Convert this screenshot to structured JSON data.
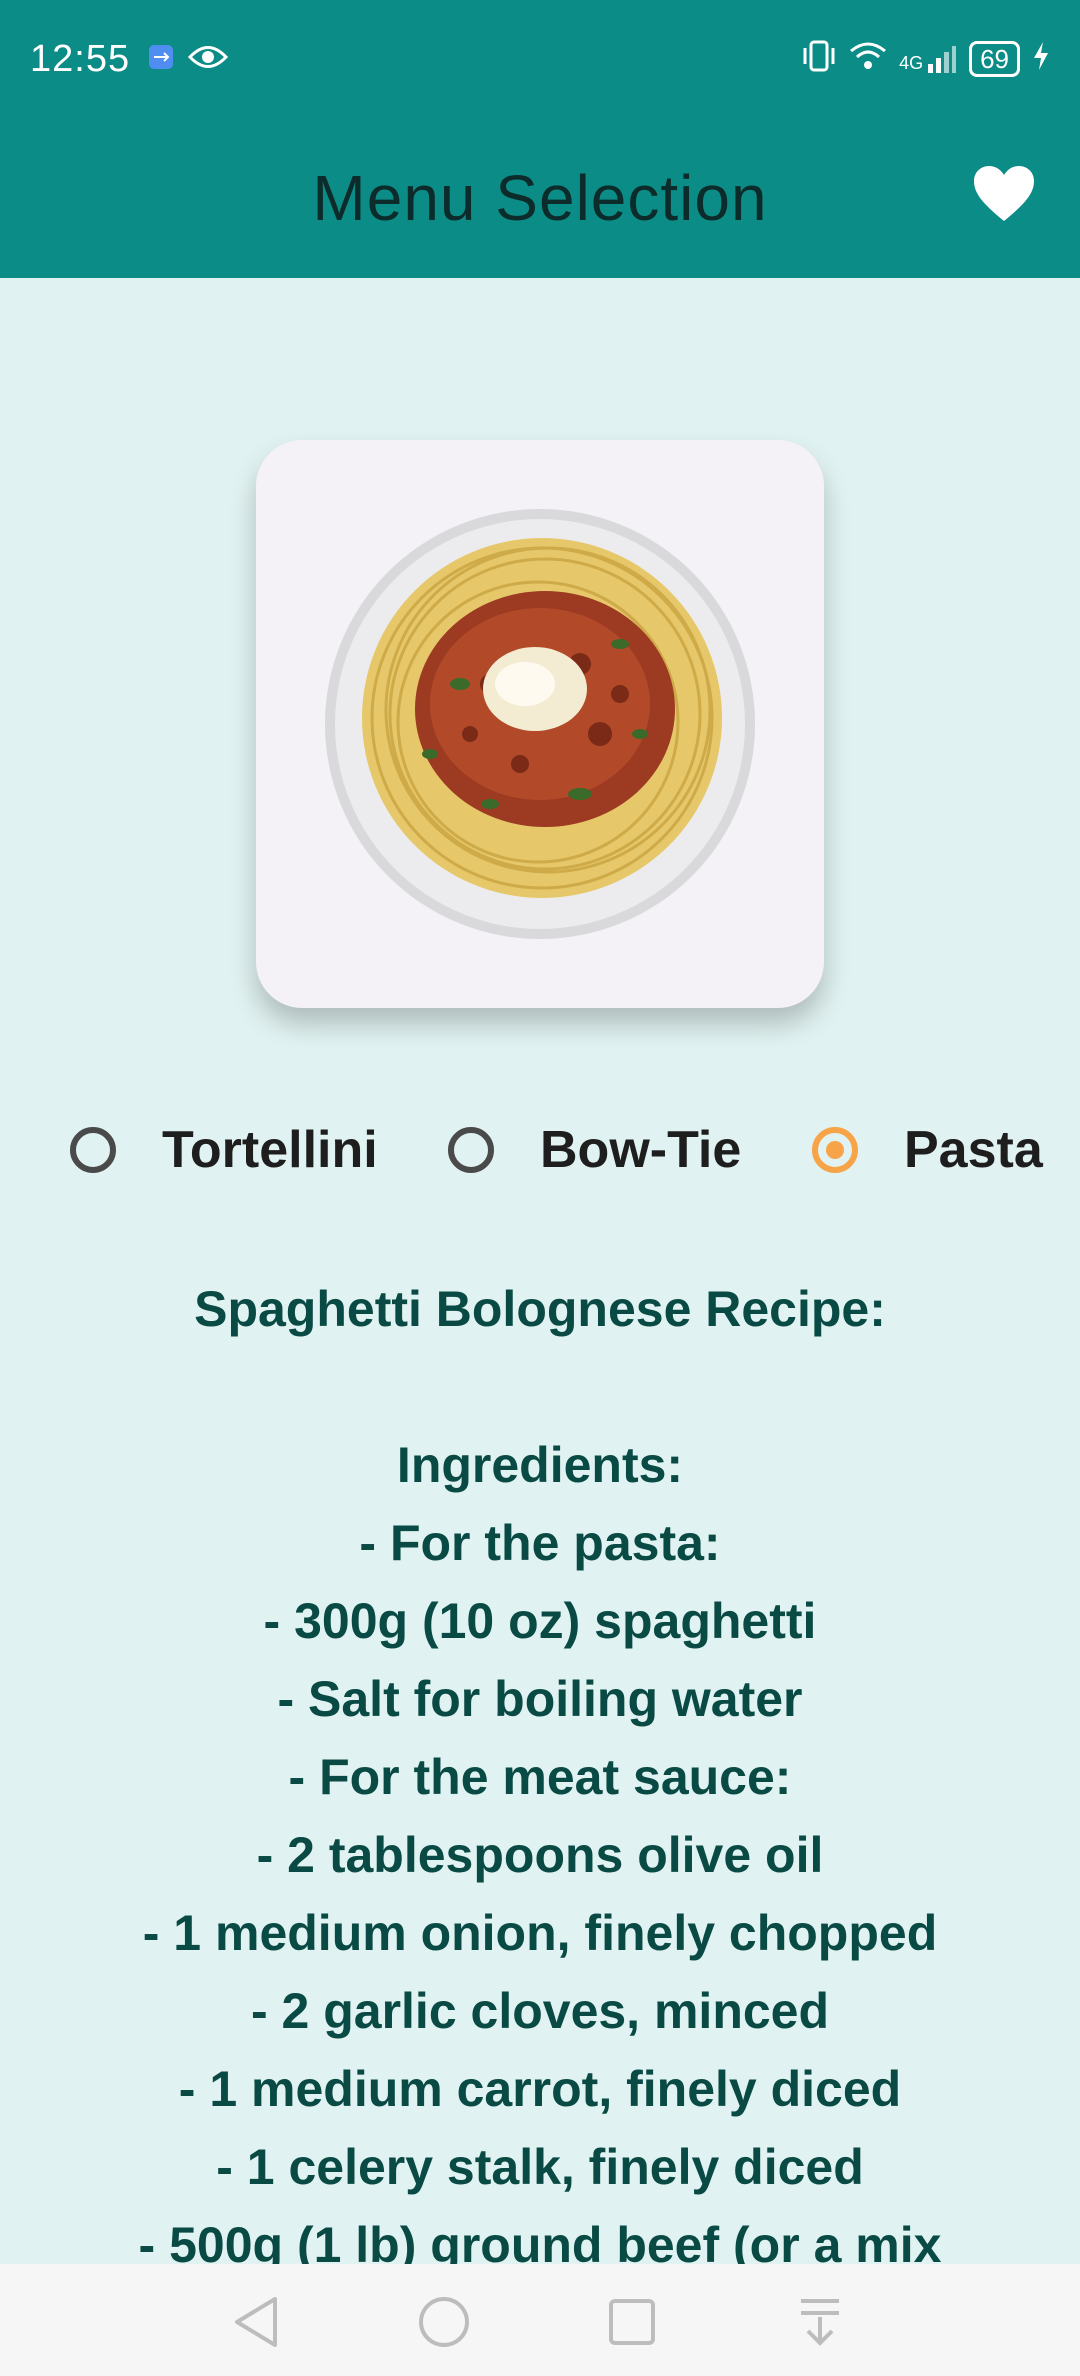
{
  "status_bar": {
    "time": "12:55",
    "battery": "69",
    "network": "4G",
    "icons": [
      "usb-icon",
      "eye-icon",
      "vibrate-icon",
      "wifi-icon",
      "signal-icon",
      "battery-icon",
      "charging-icon"
    ]
  },
  "app_bar": {
    "title": "Menu Selection",
    "favorite_icon": "heart-icon"
  },
  "food_image": {
    "description_icon": "spaghetti-plate-image"
  },
  "radio_options": [
    {
      "label": "Tortellini",
      "checked": false
    },
    {
      "label": "Bow-Tie",
      "checked": false
    },
    {
      "label": "Pasta",
      "checked": true
    }
  ],
  "recipe": {
    "title": "Spaghetti Bolognese Recipe:",
    "lines": [
      "Ingredients:",
      "- For the pasta:",
      "- 300g (10 oz) spaghetti",
      "- Salt for boiling water",
      "- For the meat sauce:",
      "- 2 tablespoons olive oil",
      "- 1 medium onion, finely chopped",
      "- 2 garlic cloves, minced",
      "- 1 medium carrot, finely diced",
      "- 1 celery stalk, finely diced",
      "- 500g (1 lb) ground beef (or a mix"
    ]
  },
  "colors": {
    "primary": "#0c8c86",
    "background": "#e0f2f1",
    "accent": "#f6a447",
    "recipe_text": "#0a4a44"
  },
  "nav_bar": {
    "icons": [
      "back-icon",
      "home-icon",
      "recents-icon",
      "notification-pull-icon"
    ]
  }
}
